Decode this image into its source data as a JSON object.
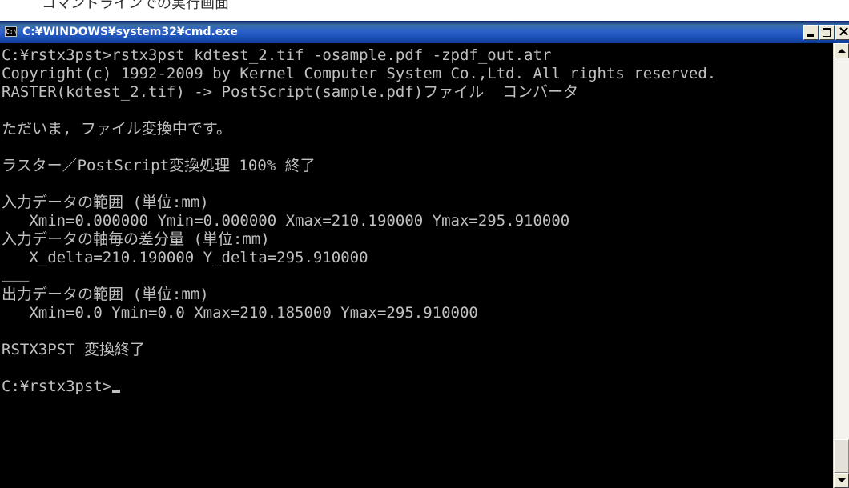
{
  "page_caption": "コマンドラインでの実行画面",
  "window": {
    "title": "C:¥WINDOWS¥system32¥cmd.exe",
    "icon_label": "C:\\",
    "icon": "console-app-icon",
    "controls": {
      "minimize": "minimize-icon",
      "maximize": "maximize-icon",
      "close": "close-icon"
    }
  },
  "console": {
    "lines": [
      "C:¥rstx3pst>rstx3pst kdtest_2.tif -osample.pdf -zpdf_out.atr",
      "Copyright(c) 1992-2009 by Kernel Computer System Co.,Ltd. All rights reserved.",
      "RASTER(kdtest_2.tif) -> PostScript(sample.pdf)ファイル  コンバータ",
      "",
      "ただいま, ファイル変換中です。",
      "",
      "ラスター／PostScript変換処理 100% 終了",
      "",
      "入力データの範囲 (単位:mm)",
      "   Xmin=0.000000 Ymin=0.000000 Xmax=210.190000 Ymax=295.910000",
      "入力データの軸毎の差分量 (単位:mm)",
      "   X_delta=210.190000 Y_delta=295.910000",
      "___",
      "出力データの範囲 (単位:mm)",
      "   Xmin=0.0 Ymin=0.0 Xmax=210.185000 Ymax=295.910000",
      "",
      "RSTX3PST 変換終了",
      "",
      "C:¥rstx3pst>"
    ]
  },
  "scrollbar": {
    "up": "scroll-up-arrow-icon",
    "down": "scroll-down-arrow-icon",
    "position_fraction": 1.0
  },
  "colors": {
    "console_bg": "#000000",
    "console_text": "#c0c0c0",
    "titlebar": "#2d63c8",
    "title_text": "#ffffff"
  }
}
